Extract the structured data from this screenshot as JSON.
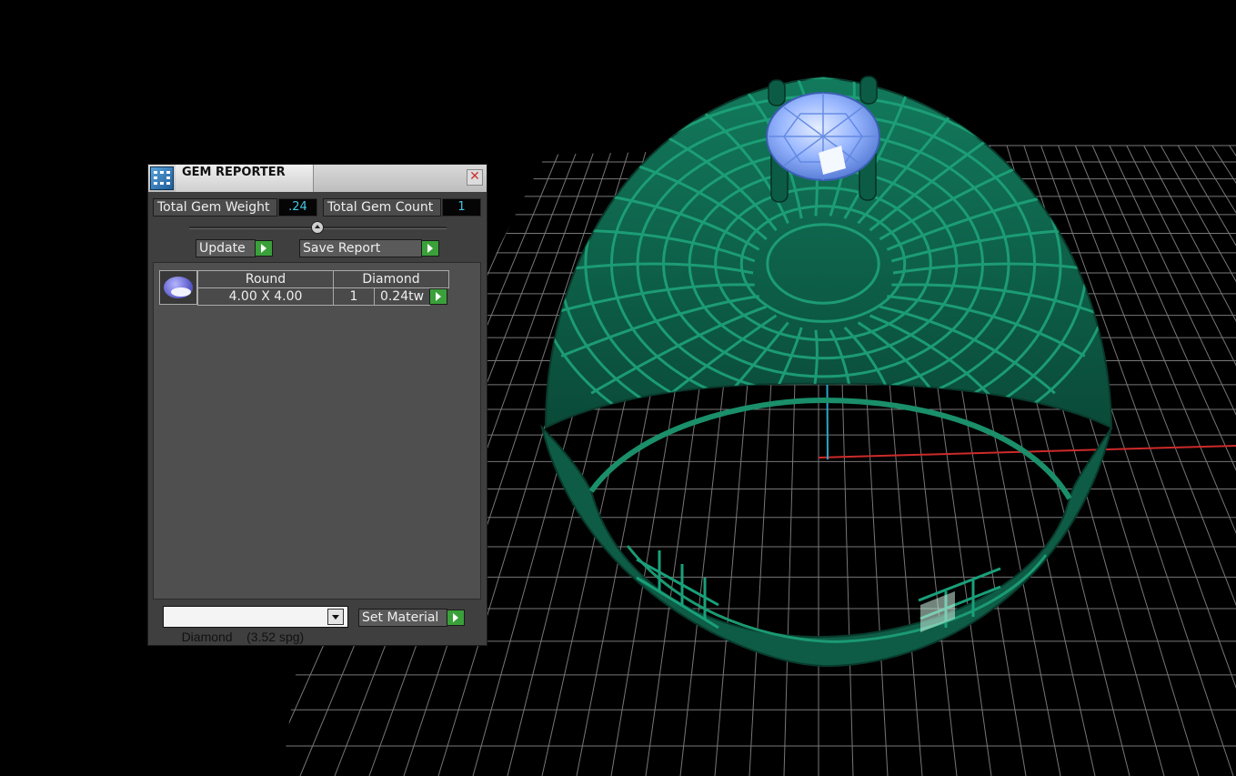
{
  "window": {
    "title": "GEM REPORTER",
    "close_symbol": "✕"
  },
  "stats": {
    "weight_label": "Total Gem Weight",
    "weight_value": ".24",
    "count_label": "Total Gem Count",
    "count_value": "1"
  },
  "actions": {
    "update_label": "Update",
    "save_label": "Save Report"
  },
  "gems": [
    {
      "shape": "Round",
      "material": "Diamond",
      "size": "4.00 X 4.00",
      "count": "1",
      "weight": "0.24tw",
      "icon": "gem-icon"
    }
  ],
  "footer": {
    "material_selected": "Diamond    (3.52 spg)",
    "set_material_label": "Set Material"
  },
  "colors": {
    "ring": "#0f5a45",
    "gem": "#8fb2ff",
    "grid": "#9a9a9a",
    "value_text": "#41c8e6",
    "go_button": "#3aa03a"
  }
}
